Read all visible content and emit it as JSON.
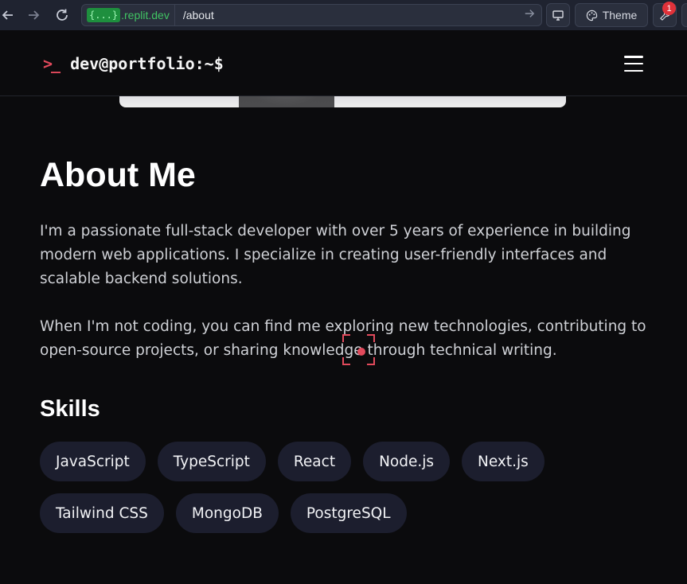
{
  "browser": {
    "back_icon": "arrow-left-icon",
    "forward_icon": "arrow-right-icon",
    "reload_icon": "reload-icon",
    "url_badge": "{...}",
    "url_domain": ".replit.dev",
    "url_path": "/about",
    "go_icon": "arrow-right-icon",
    "devices_icon": "monitor-icon",
    "theme_icon": "palette-icon",
    "theme_label": "Theme",
    "tools_icon": "wrench-icon",
    "tools_badge": "1"
  },
  "header": {
    "logo_prompt": ">_",
    "logo_text": "dev@portfolio:~$",
    "menu_icon": "hamburger-menu-icon"
  },
  "about": {
    "title": "About Me",
    "paragraph1": "I'm a passionate full-stack developer with over 5 years of experience in building modern web applications. I specialize in creating user-friendly interfaces and scalable backend solutions.",
    "paragraph2": "When I'm not coding, you can find me exploring new technologies, contributing to open-source projects, or sharing knowledge through technical writing."
  },
  "skills": {
    "title": "Skills",
    "row1": [
      "JavaScript",
      "TypeScript",
      "React",
      "Node.js",
      "Next.js"
    ],
    "row2": [
      "Tailwind CSS",
      "MongoDB",
      "PostgreSQL"
    ]
  },
  "colors": {
    "accent": "#e24a5c",
    "background": "#0b0b0d",
    "chip": "#1c1e2e",
    "url_domain": "#40c463"
  }
}
